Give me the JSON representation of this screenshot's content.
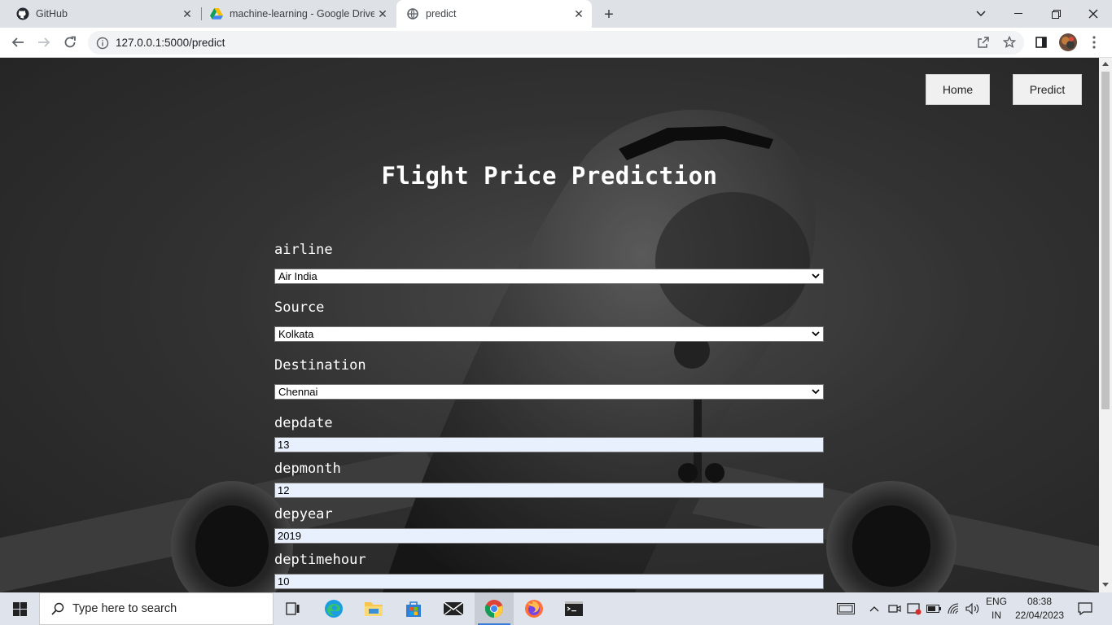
{
  "browser": {
    "tabs": [
      {
        "title": "GitHub",
        "icon": "github-icon"
      },
      {
        "title": "machine-learning - Google Drive",
        "icon": "google-drive-icon"
      },
      {
        "title": "predict",
        "icon": "globe-icon",
        "active": true
      }
    ],
    "url": "127.0.0.1:5000/predict"
  },
  "nav": {
    "home_label": "Home",
    "predict_label": "Predict"
  },
  "page": {
    "title": "Flight Price Prediction"
  },
  "form": {
    "airline": {
      "label": "airline",
      "value": "Air India"
    },
    "source": {
      "label": "Source",
      "value": "Kolkata"
    },
    "destination": {
      "label": "Destination",
      "value": "Chennai"
    },
    "depdate": {
      "label": "depdate",
      "value": "13"
    },
    "depmonth": {
      "label": "depmonth",
      "value": "12"
    },
    "depyear": {
      "label": "depyear",
      "value": "2019"
    },
    "deptimehour": {
      "label": "deptimehour",
      "value": "10"
    }
  },
  "taskbar": {
    "search_placeholder": "Type here to search",
    "lang_top": "ENG",
    "lang_bottom": "IN",
    "time": "08:38",
    "date": "22/04/2023"
  },
  "colors": {
    "page_bg": "#3d3d3d",
    "input_autofill": "#e8f0fe",
    "tabstrip": "#dee1e6",
    "taskbar": "#dfe3eb"
  }
}
